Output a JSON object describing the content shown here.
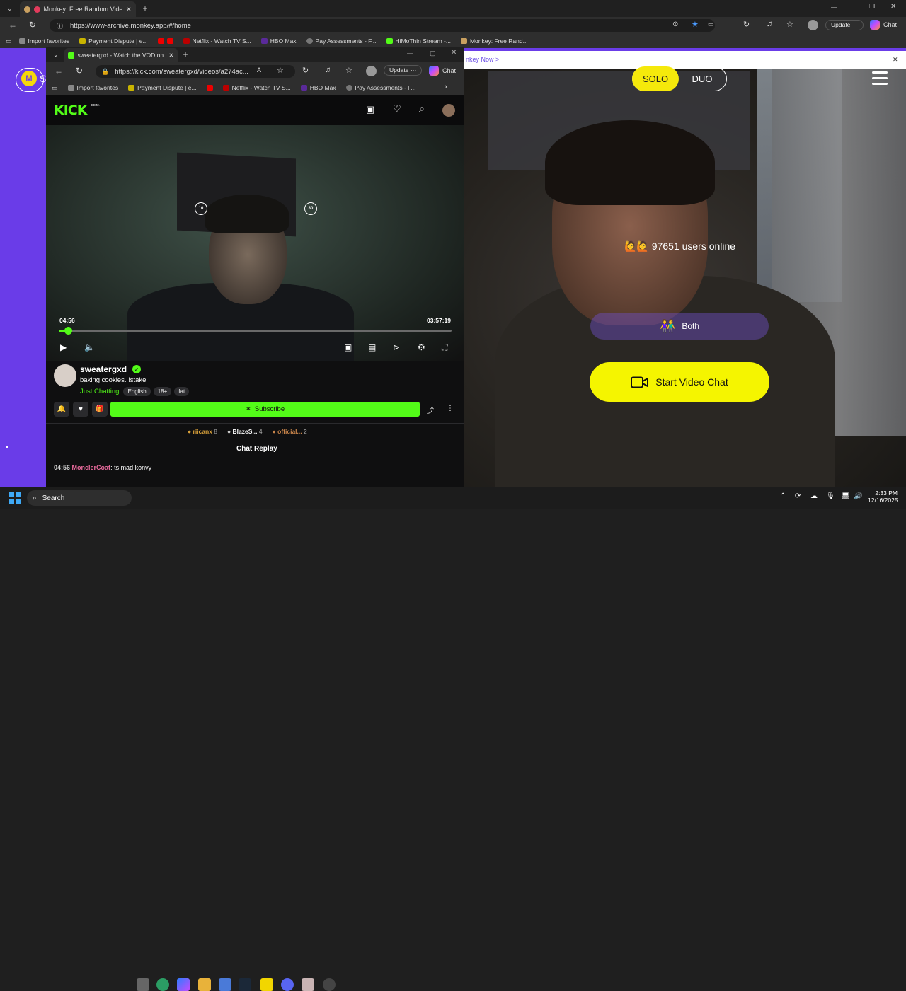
{
  "main_browser": {
    "tab_title": "Monkey: Free Random Vide",
    "url": "https://www-archive.monkey.app/#/home",
    "update_label": "Update",
    "chat_label": "Chat",
    "favorites": [
      "Import favorites",
      "Payment Dispute | e...",
      "Netflix - Watch TV S...",
      "HBO Max",
      "Pay Assessments - F...",
      "HiMoThin Stream -...",
      "Monkey: Free Rand..."
    ]
  },
  "popup_browser": {
    "tab_title": "sweatergxd - Watch the VOD on",
    "url": "https://kick.com/sweatergxd/videos/a274ac...",
    "update_label": "Update",
    "chat_label": "Chat",
    "favorites": [
      "Import favorites",
      "Payment Dispute | e...",
      "Netflix - Watch TV S...",
      "HBO Max",
      "Pay Assessments - F..."
    ]
  },
  "kick": {
    "logo": "KICK",
    "beta": "BETA",
    "player": {
      "current_time": "04:56",
      "duration": "03:57:19",
      "progress_fraction": 0.021,
      "rewind_label": "10",
      "forward_label": "30"
    },
    "streamer": {
      "name": "sweatergxd",
      "title": "baking cookies. !stake",
      "category": "Just Chatting",
      "tags": [
        "English",
        "18+",
        "fat"
      ]
    },
    "subscribe_label": "Subscribe",
    "gifters": [
      {
        "name": "riicanx",
        "count": "8"
      },
      {
        "name": "BlazeS...",
        "count": "4"
      },
      {
        "name": "official...",
        "count": "2"
      }
    ],
    "chat_replay_label": "Chat Replay",
    "chat_messages": [
      {
        "time": "04:56",
        "user": "MonclerCoat",
        "text": ": ts mad konvy"
      }
    ]
  },
  "monkey": {
    "banner_text": "nkey Now >",
    "mode_solo": "SOLO",
    "mode_duo": "DUO",
    "online_text": "97651 users online",
    "online_emoji": "🙋🙋",
    "gender_filter": "Both",
    "gender_emoji": "👫",
    "start_button": "Start Video Chat",
    "logo_letter": "M",
    "logo_partial": "S"
  },
  "taskbar": {
    "search_placeholder": "Search",
    "time": "2:33 PM",
    "date": "12/16/2025"
  },
  "colors": {
    "kick_green": "#53fc18",
    "monkey_yellow": "#f5f500",
    "monkey_purple": "#6a3ce8"
  }
}
